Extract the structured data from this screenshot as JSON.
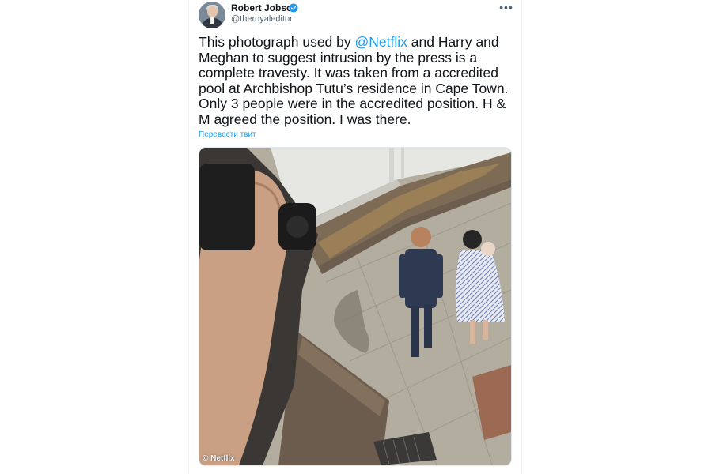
{
  "tweet": {
    "author_name": "Robert Jobson",
    "author_handle": "@theroyaleditor",
    "verified": true,
    "text_before_mention": "This photograph used by ",
    "mention": "@Netflix",
    "text_after_mention": " and Harry and Meghan to suggest intrusion by the press is a complete travesty. It was taken from a accredited pool at Archbishop Tutu’s residence in Cape Town. Only 3 people were in the accredited position. H & M agreed the position. I was there.",
    "translate_link": "Перевести твит",
    "more_icon": "more-options-icon"
  },
  "media": {
    "watermark": "© Netflix"
  },
  "colors": {
    "link": "#1d9bf0",
    "text": "#0f1419",
    "secondary": "#536471",
    "verified": "#1d9bf0"
  }
}
